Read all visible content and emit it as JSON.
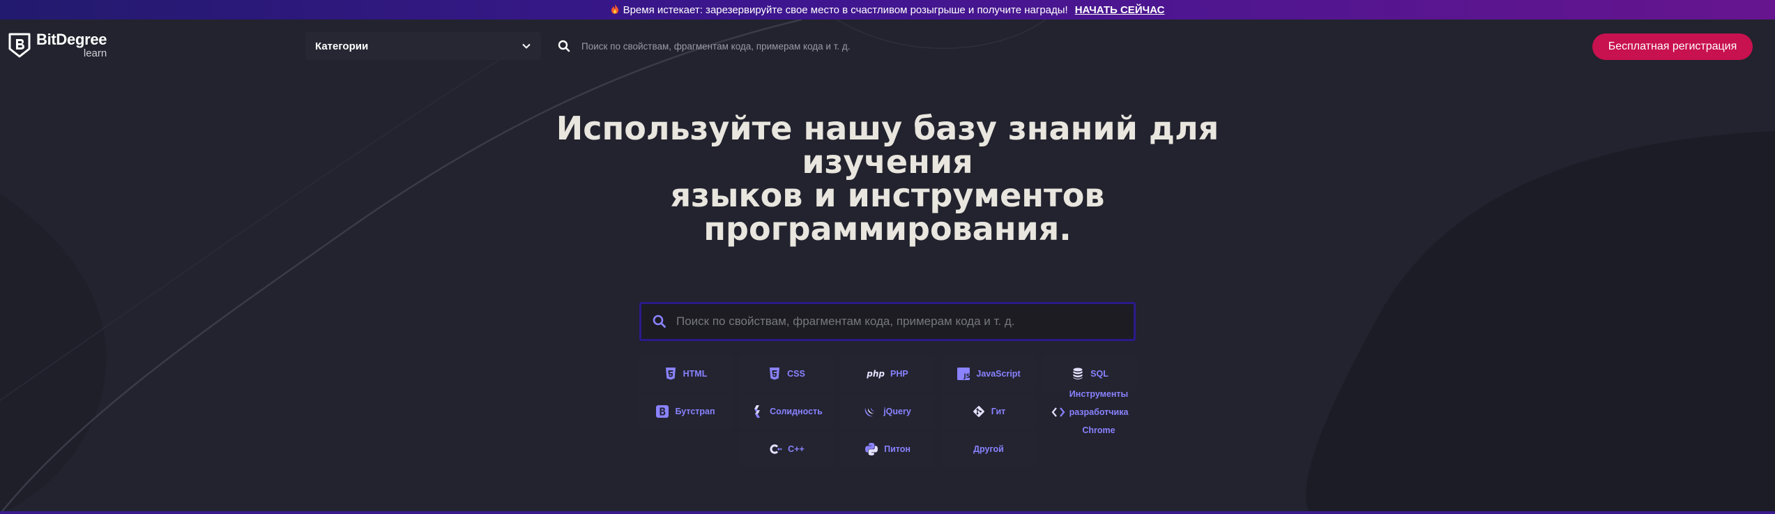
{
  "banner": {
    "icon": "fire-icon",
    "text": "Время истекает: зарезервируйте свое место в счастливом розыгрыше и получите награды!",
    "cta": "НАЧАТЬ СЕЙЧАС"
  },
  "header": {
    "logo_name": "BitDegree",
    "logo_sub": "learn",
    "categories_label": "Категории",
    "search_placeholder": "Поиск по свойствам, фрагментам кода, примерам кода и т. д.",
    "signup_label": "Бесплатная регистрация"
  },
  "hero": {
    "title_lines": [
      "Используйте нашу базу знаний для",
      "изучения",
      "языков и инструментов",
      "программирования."
    ],
    "search_placeholder": "Поиск по свойствам, фрагментам кода, примерам кода и т. д."
  },
  "categories": [
    {
      "label": "HTML",
      "icon": "html5-icon"
    },
    {
      "label": "CSS",
      "icon": "css3-icon"
    },
    {
      "label": "PHP",
      "icon": "php-icon"
    },
    {
      "label": "JavaScript",
      "icon": "javascript-icon"
    },
    {
      "label": "SQL",
      "icon": "database-icon"
    },
    {
      "label": "Бутстрап",
      "icon": "bootstrap-icon"
    },
    {
      "label": "Солидность",
      "icon": "solidity-icon"
    },
    {
      "label": "jQuery",
      "icon": "jquery-icon"
    },
    {
      "label": "Гит",
      "icon": "git-icon"
    },
    {
      "label_lines": [
        "Инструменты",
        "разработчика",
        "Chrome"
      ],
      "icon": "code-brackets-icon"
    },
    {
      "label": "C++",
      "icon": "cplusplus-icon"
    },
    {
      "label": "Питон",
      "icon": "python-icon"
    },
    {
      "label": "Другой",
      "icon": ""
    }
  ],
  "colors": {
    "background": "#22232e",
    "accent": "#8a82ff",
    "signup": "#c8114f",
    "search_border": "#2a1a8a"
  }
}
